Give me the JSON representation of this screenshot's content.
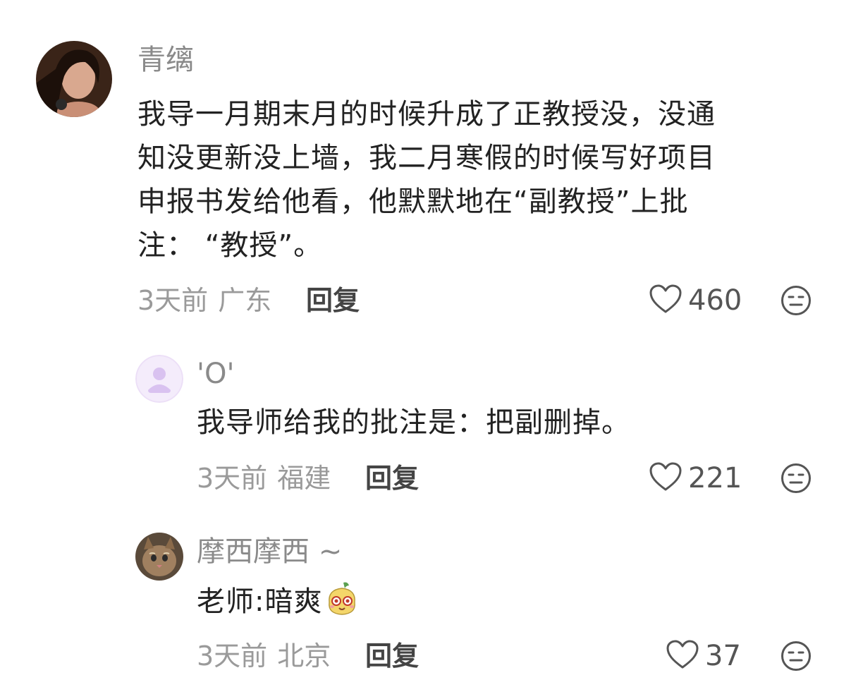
{
  "comments": [
    {
      "username": "青缡",
      "text_lines": [
        "我导一月期末月的时候升成了正教授没，没通",
        "知没更新没上墙，我二月寒假的时候写好项目",
        "申报书发给他看，他默默地在“副教授”上批",
        "注：  “教授”。"
      ],
      "time": "3天前",
      "location": "广东",
      "reply_label": "回复",
      "likes": "460"
    },
    {
      "username": "'O'",
      "text": "我导师给我的批注是：把副删掉。",
      "time": "3天前",
      "location": "福建",
      "reply_label": "回复",
      "likes": "221"
    },
    {
      "username": "摩西摩西 ~",
      "text": "老师:暗爽",
      "time": "3天前",
      "location": "北京",
      "reply_label": "回复",
      "likes": "37"
    }
  ],
  "icons": {
    "like": "heart-outline-icon",
    "reaction": "neutral-face-icon",
    "emoji": "sticker-emoji-icon"
  }
}
